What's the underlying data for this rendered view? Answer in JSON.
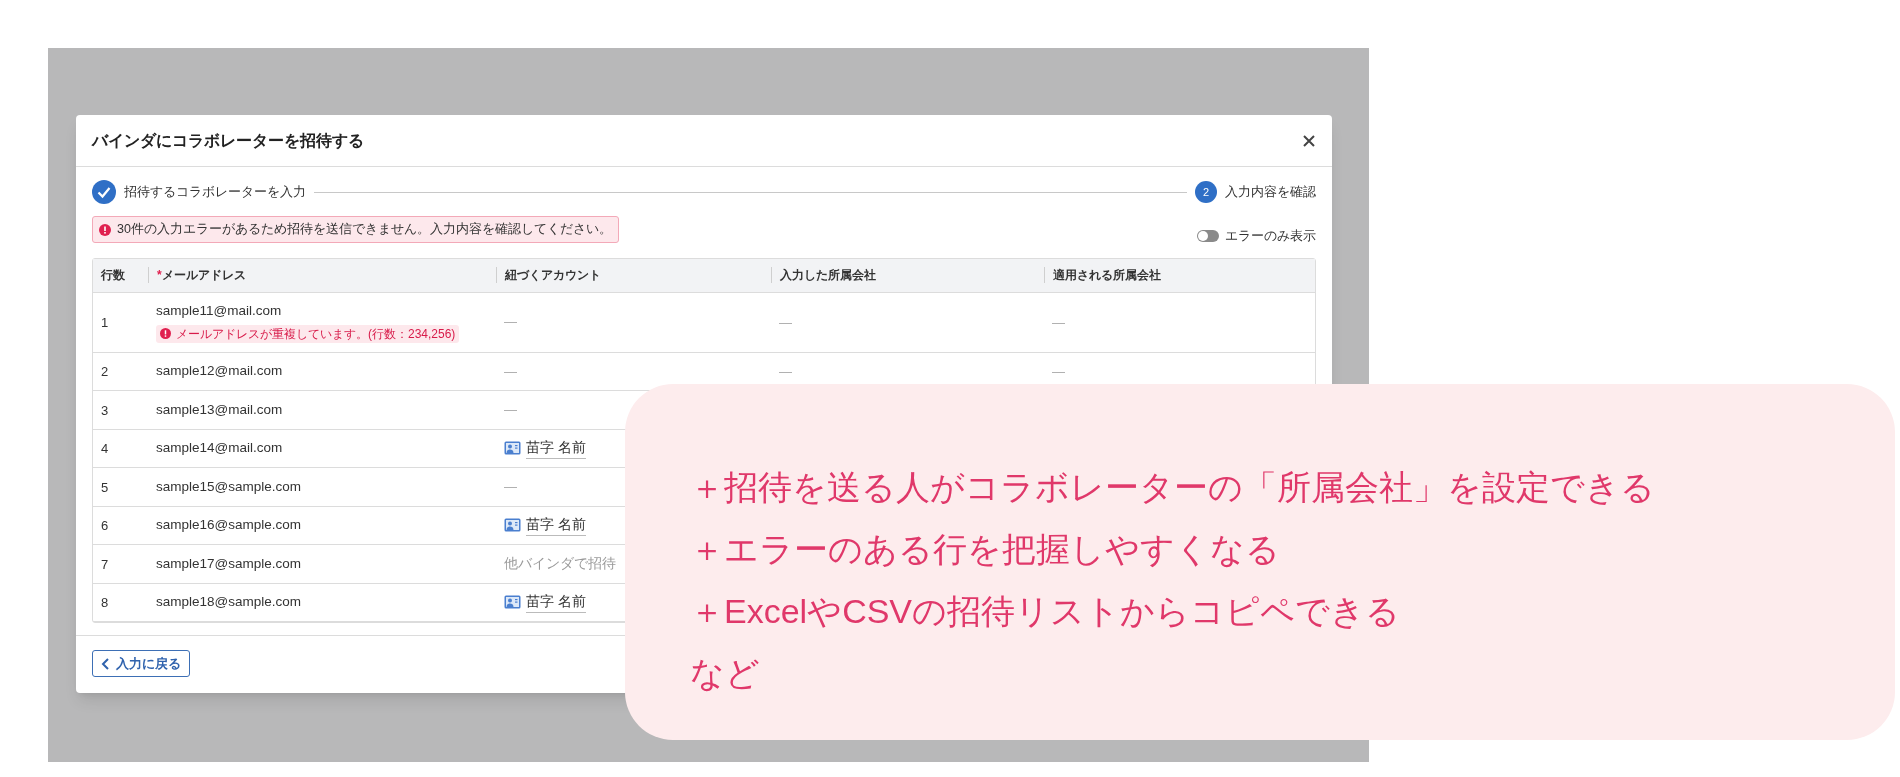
{
  "dialog": {
    "title": "バインダにコラボレーターを招待する"
  },
  "steps": [
    {
      "kind": "done",
      "label": "招待するコラボレーターを入力"
    },
    {
      "kind": "current",
      "number": "2",
      "label": "入力内容を確認"
    }
  ],
  "error_alert": "30件の入力エラーがあるため招待を送信できません。入力内容を確認してください。",
  "toggle": {
    "label": "エラーのみ表示",
    "on": false
  },
  "table": {
    "columns": [
      {
        "label": "行数"
      },
      {
        "label": "メールアドレス",
        "required_mark": "*"
      },
      {
        "label": "紐づくアカウント"
      },
      {
        "label": "入力した所属会社"
      },
      {
        "label": "適用される所属会社"
      }
    ],
    "rows": [
      {
        "row_number": "1",
        "email": "sample11@mail.com",
        "error": "メールアドレスが重複しています。(行数：234,256)",
        "account": {
          "kind": "none",
          "text": "—"
        },
        "entered_company": "—",
        "applied_company": "—"
      },
      {
        "row_number": "2",
        "email": "sample12@mail.com",
        "account": {
          "kind": "none",
          "text": "—"
        },
        "entered_company": "—",
        "applied_company": "—"
      },
      {
        "row_number": "3",
        "email": "sample13@mail.com",
        "account": {
          "kind": "none",
          "text": "—"
        }
      },
      {
        "row_number": "4",
        "email": "sample14@mail.com",
        "account": {
          "kind": "user",
          "text": "苗字 名前"
        }
      },
      {
        "row_number": "5",
        "email": "sample15@sample.com",
        "account": {
          "kind": "none",
          "text": "—"
        }
      },
      {
        "row_number": "6",
        "email": "sample16@sample.com",
        "account": {
          "kind": "user",
          "text": "苗字 名前"
        }
      },
      {
        "row_number": "7",
        "email": "sample17@sample.com",
        "account": {
          "kind": "note",
          "text": "他バインダで招待"
        }
      },
      {
        "row_number": "8",
        "email": "sample18@sample.com",
        "account": {
          "kind": "user",
          "text": "苗字 名前"
        }
      }
    ]
  },
  "back_button": "入力に戻る",
  "callout": {
    "lines": [
      "＋招待を送る人がコラボレーターの「所属会社」を設定できる",
      "＋エラーのある行を把握しやすくなる",
      "＋ExcelやCSVの招待リストからコピペできる",
      "など"
    ]
  }
}
